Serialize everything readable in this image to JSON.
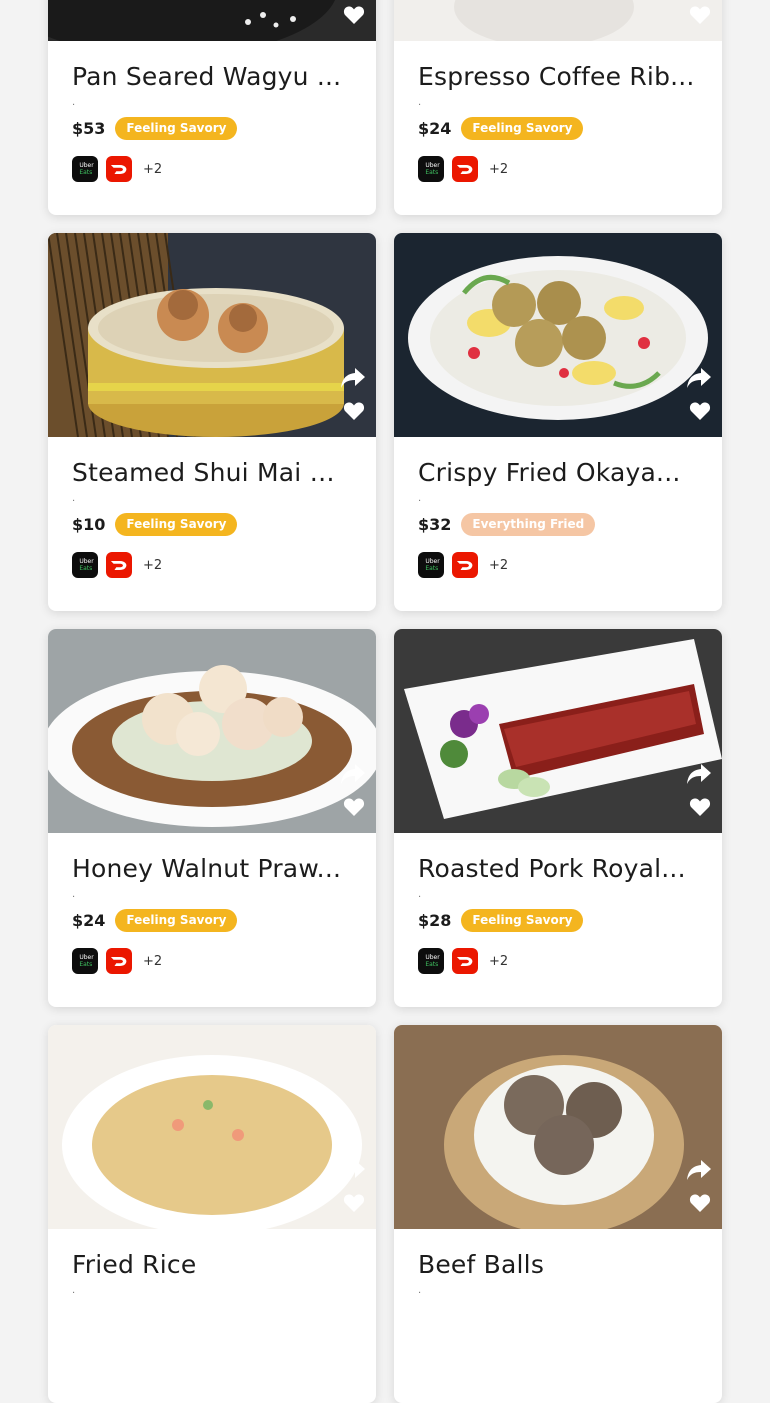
{
  "cards": [
    {
      "title": "Pan Seared Wagyu ...",
      "dot": ".",
      "price": "$53",
      "tag": "Feeling Savory",
      "tag_style": "gold",
      "apps": [
        "Uber Eats",
        "DoorDash"
      ],
      "more": "+2",
      "photo": "wagyu-dish-photo"
    },
    {
      "title": "Espresso Coffee Rib...",
      "dot": ".",
      "price": "$24",
      "tag": "Feeling Savory",
      "tag_style": "gold",
      "apps": [
        "Uber Eats",
        "DoorDash"
      ],
      "more": "+2",
      "photo": "coffee-ribs-photo"
    },
    {
      "title": "Steamed Shui Mai w...",
      "dot": ".",
      "price": "$10",
      "tag": "Feeling Savory",
      "tag_style": "gold",
      "apps": [
        "Uber Eats",
        "DoorDash"
      ],
      "more": "+2",
      "photo": "shui-mai-basket-photo"
    },
    {
      "title": "Crispy Fried Okaya...",
      "dot": ".",
      "price": "$32",
      "tag": "Everything Fried",
      "tag_style": "peach",
      "apps": [
        "Uber Eats",
        "DoorDash"
      ],
      "more": "+2",
      "photo": "fried-fish-plate-photo"
    },
    {
      "title": "Honey Walnut Praw...",
      "dot": ".",
      "price": "$24",
      "tag": "Feeling Savory",
      "tag_style": "gold",
      "apps": [
        "Uber Eats",
        "DoorDash"
      ],
      "more": "+2",
      "photo": "walnut-prawn-plate-photo"
    },
    {
      "title": "Roasted Pork Royal...",
      "dot": ".",
      "price": "$28",
      "tag": "Feeling Savory",
      "tag_style": "gold",
      "apps": [
        "Uber Eats",
        "DoorDash"
      ],
      "more": "+2",
      "photo": "roast-pork-plate-photo"
    },
    {
      "title": "Fried Rice",
      "dot": ".",
      "price": "",
      "tag": "",
      "tag_style": "gold",
      "apps": [],
      "more": "",
      "photo": "fried-rice-photo"
    },
    {
      "title": "Beef Balls",
      "dot": ".",
      "price": "",
      "tag": "",
      "tag_style": "gold",
      "apps": [],
      "more": "",
      "photo": "beef-balls-photo"
    }
  ],
  "uber_label": {
    "line1": "Uber",
    "line2": "Eats"
  },
  "colors": {
    "tag_gold": "#f4b51f",
    "tag_peach": "#f5c6a4",
    "doordash": "#eb1700",
    "ubereats": "#0d0d0d"
  }
}
